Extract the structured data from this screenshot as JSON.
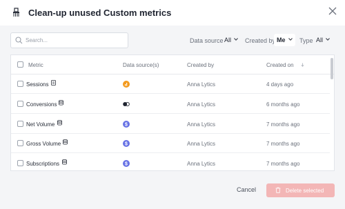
{
  "dialog": {
    "title": "Clean-up unused Custom metrics",
    "title_icon": "broom-icon",
    "close_icon": "close-icon"
  },
  "search": {
    "placeholder": "Search...",
    "value": ""
  },
  "filters": [
    {
      "label": "Data source",
      "value": "All"
    },
    {
      "label": "Created by",
      "value": "Me"
    },
    {
      "label": "Type",
      "value": "All"
    }
  ],
  "table": {
    "columns": [
      "Metric",
      "Data source(s)",
      "Created by",
      "Created on"
    ],
    "sort_icon": "sort-arrow-icon",
    "rows": [
      {
        "metric": "Sessions",
        "type_icon": "document-icon",
        "source_icon": "google-analytics-icon",
        "created_by": "Anna Lytics",
        "created_on": "4 days ago"
      },
      {
        "metric": "Conversions",
        "type_icon": "database-icon",
        "source_icon": "toggle-icon",
        "created_by": "Anna Lytics",
        "created_on": "6 months ago"
      },
      {
        "metric": "Net Volume",
        "type_icon": "database-icon",
        "source_icon": "stripe-icon",
        "created_by": "Anna Lytics",
        "created_on": "7 months ago"
      },
      {
        "metric": "Gross Volume",
        "type_icon": "database-icon",
        "source_icon": "stripe-icon",
        "created_by": "Anna Lytics",
        "created_on": "7 months ago"
      },
      {
        "metric": "Subscriptions",
        "type_icon": "database-icon",
        "source_icon": "stripe-icon",
        "created_by": "Anna Lytics",
        "created_on": "7 months ago"
      }
    ]
  },
  "footer": {
    "cancel_label": "Cancel",
    "delete_label": "Delete selected",
    "delete_icon": "trash-icon"
  },
  "colors": {
    "accent_danger_disabled": "#f3b6b6",
    "ga_orange": "#f39a1e",
    "stripe_purple": "#6772e5"
  }
}
